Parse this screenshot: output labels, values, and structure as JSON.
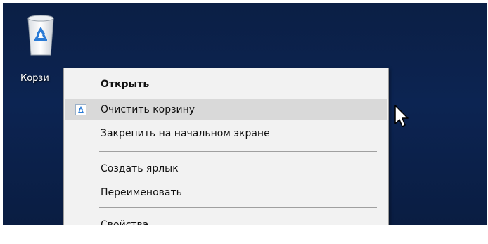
{
  "desktop": {
    "icon_label": "Корзи"
  },
  "context_menu": {
    "items": [
      {
        "label": "Открыть",
        "bold": true
      },
      {
        "label": "Очистить корзину",
        "icon": "recycle-bin-small-icon",
        "highlighted": true
      },
      {
        "label": "Закрепить на начальном экране"
      },
      {
        "label": "Создать ярлык"
      },
      {
        "label": "Переименовать"
      },
      {
        "label": "Свойства"
      }
    ]
  },
  "colors": {
    "desktop_bg": "#0c2452",
    "menu_bg": "#f2f2f2",
    "highlight": "#d9d9d9"
  }
}
